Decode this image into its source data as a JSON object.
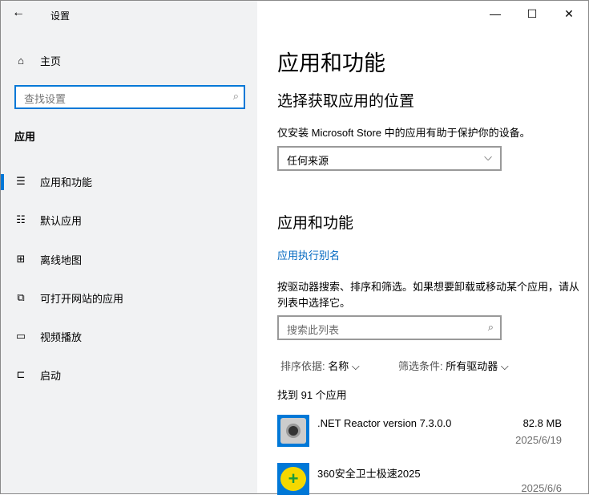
{
  "window": {
    "title": "设置",
    "back": "←",
    "minimize": "—",
    "maximize": "☐",
    "close": "✕"
  },
  "sidebar": {
    "home": "主页",
    "search_placeholder": "查找设置",
    "section": "应用",
    "items": [
      {
        "label": "应用和功能",
        "icon": "list-icon"
      },
      {
        "label": "默认应用",
        "icon": "default-apps-icon"
      },
      {
        "label": "离线地图",
        "icon": "map-icon"
      },
      {
        "label": "可打开网站的应用",
        "icon": "web-app-icon"
      },
      {
        "label": "视频播放",
        "icon": "video-icon"
      },
      {
        "label": "启动",
        "icon": "startup-icon"
      }
    ]
  },
  "main": {
    "title": "应用和功能",
    "source_heading": "选择获取应用的位置",
    "source_desc": "仅安装 Microsoft Store 中的应用有助于保护你的设备。",
    "source_value": "任何来源",
    "apps_heading": "应用和功能",
    "alias_link": "应用执行别名",
    "search_desc": "按驱动器搜索、排序和筛选。如果想要卸载或移动某个应用，请从列表中选择它。",
    "search_placeholder": "搜索此列表",
    "sort_label": "排序依据:",
    "sort_value": "名称",
    "filter_label": "筛选条件:",
    "filter_value": "所有驱动器",
    "count": "找到 91 个应用",
    "apps": [
      {
        "name": ".NET Reactor version 7.3.0.0",
        "size": "82.8 MB",
        "date": "2025/6/19"
      },
      {
        "name": "360安全卫士极速2025",
        "size": "",
        "date": "2025/6/6"
      }
    ]
  },
  "colors": {
    "accent": "#0078d7",
    "link": "#0067c0"
  }
}
